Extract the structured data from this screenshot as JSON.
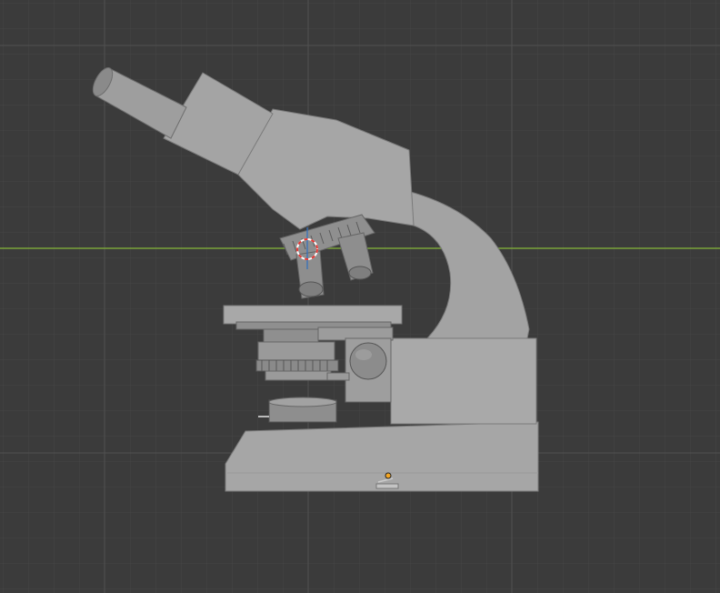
{
  "viewport": {
    "background": "#3b3b3b",
    "grid_minor_color": "#464646",
    "grid_major_color": "#555555",
    "axis_x_color": "#7aa33a",
    "axis_y_color": "#2f6fbf",
    "origin_color": "#f5a623"
  },
  "object": {
    "body_color": "#a6a6a6",
    "shade_color": "#8f8f8f",
    "dark_color": "#6e6e6e",
    "light_color": "#b8b8b8"
  },
  "cursor": {
    "ring_color_a": "#e53935",
    "ring_color_b": "#ffffff"
  }
}
